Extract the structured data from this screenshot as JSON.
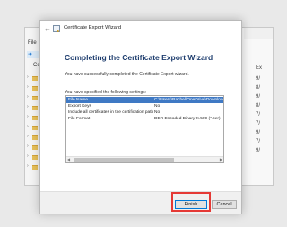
{
  "background_window": {
    "menu_file": "File",
    "tree_label": "Certific",
    "right_items": [
      "Ex",
      "9/",
      "8/",
      "9/",
      "8/",
      "7/",
      "7/",
      "9/",
      "7/",
      "9/"
    ]
  },
  "dialog": {
    "title": "Certificate Export Wizard",
    "heading": "Completing the Certificate Export Wizard",
    "description": "You have successfully completed the Certificate Export wizard.",
    "settings_label": "You have specified the following settings:",
    "settings": [
      {
        "key": "File Name",
        "value": "C:\\Users\\Rachel\\OneDrive\\Downloads\\",
        "selected": true
      },
      {
        "key": "Export Keys",
        "value": "No",
        "selected": false
      },
      {
        "key": "Include all certificates in the certification path",
        "value": "No",
        "selected": false
      },
      {
        "key": "File Format",
        "value": "DER Encoded Binary X.509 (*.cer)",
        "selected": false
      }
    ],
    "buttons": {
      "finish": "Finish",
      "cancel": "Cancel"
    }
  },
  "colors": {
    "accent": "#0078d7",
    "selection": "#3f79c4",
    "heading": "#1e3d6e",
    "highlight_box": "#e53935"
  }
}
